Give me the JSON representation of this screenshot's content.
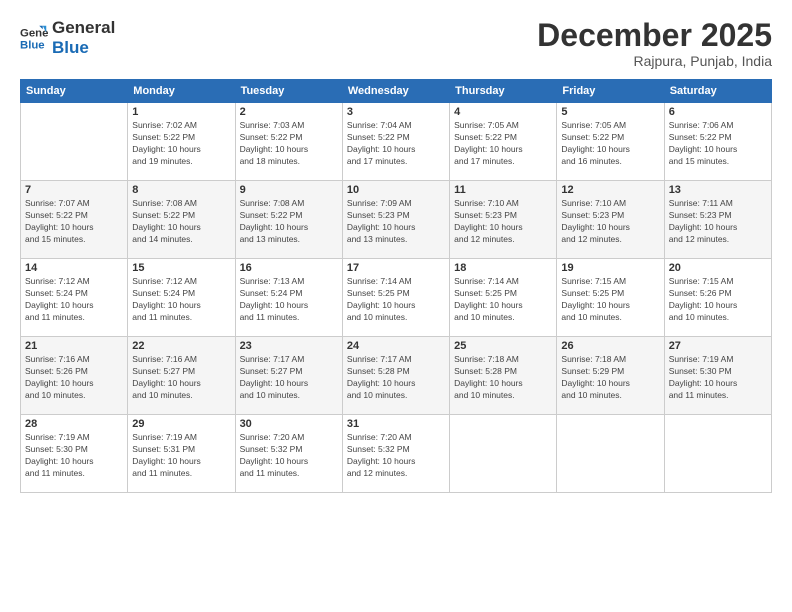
{
  "header": {
    "logo_line1": "General",
    "logo_line2": "Blue",
    "month_title": "December 2025",
    "location": "Rajpura, Punjab, India"
  },
  "weekdays": [
    "Sunday",
    "Monday",
    "Tuesday",
    "Wednesday",
    "Thursday",
    "Friday",
    "Saturday"
  ],
  "weeks": [
    [
      {
        "day": "",
        "info": ""
      },
      {
        "day": "1",
        "info": "Sunrise: 7:02 AM\nSunset: 5:22 PM\nDaylight: 10 hours\nand 19 minutes."
      },
      {
        "day": "2",
        "info": "Sunrise: 7:03 AM\nSunset: 5:22 PM\nDaylight: 10 hours\nand 18 minutes."
      },
      {
        "day": "3",
        "info": "Sunrise: 7:04 AM\nSunset: 5:22 PM\nDaylight: 10 hours\nand 17 minutes."
      },
      {
        "day": "4",
        "info": "Sunrise: 7:05 AM\nSunset: 5:22 PM\nDaylight: 10 hours\nand 17 minutes."
      },
      {
        "day": "5",
        "info": "Sunrise: 7:05 AM\nSunset: 5:22 PM\nDaylight: 10 hours\nand 16 minutes."
      },
      {
        "day": "6",
        "info": "Sunrise: 7:06 AM\nSunset: 5:22 PM\nDaylight: 10 hours\nand 15 minutes."
      }
    ],
    [
      {
        "day": "7",
        "info": "Sunrise: 7:07 AM\nSunset: 5:22 PM\nDaylight: 10 hours\nand 15 minutes."
      },
      {
        "day": "8",
        "info": "Sunrise: 7:08 AM\nSunset: 5:22 PM\nDaylight: 10 hours\nand 14 minutes."
      },
      {
        "day": "9",
        "info": "Sunrise: 7:08 AM\nSunset: 5:22 PM\nDaylight: 10 hours\nand 13 minutes."
      },
      {
        "day": "10",
        "info": "Sunrise: 7:09 AM\nSunset: 5:23 PM\nDaylight: 10 hours\nand 13 minutes."
      },
      {
        "day": "11",
        "info": "Sunrise: 7:10 AM\nSunset: 5:23 PM\nDaylight: 10 hours\nand 12 minutes."
      },
      {
        "day": "12",
        "info": "Sunrise: 7:10 AM\nSunset: 5:23 PM\nDaylight: 10 hours\nand 12 minutes."
      },
      {
        "day": "13",
        "info": "Sunrise: 7:11 AM\nSunset: 5:23 PM\nDaylight: 10 hours\nand 12 minutes."
      }
    ],
    [
      {
        "day": "14",
        "info": "Sunrise: 7:12 AM\nSunset: 5:24 PM\nDaylight: 10 hours\nand 11 minutes."
      },
      {
        "day": "15",
        "info": "Sunrise: 7:12 AM\nSunset: 5:24 PM\nDaylight: 10 hours\nand 11 minutes."
      },
      {
        "day": "16",
        "info": "Sunrise: 7:13 AM\nSunset: 5:24 PM\nDaylight: 10 hours\nand 11 minutes."
      },
      {
        "day": "17",
        "info": "Sunrise: 7:14 AM\nSunset: 5:25 PM\nDaylight: 10 hours\nand 10 minutes."
      },
      {
        "day": "18",
        "info": "Sunrise: 7:14 AM\nSunset: 5:25 PM\nDaylight: 10 hours\nand 10 minutes."
      },
      {
        "day": "19",
        "info": "Sunrise: 7:15 AM\nSunset: 5:25 PM\nDaylight: 10 hours\nand 10 minutes."
      },
      {
        "day": "20",
        "info": "Sunrise: 7:15 AM\nSunset: 5:26 PM\nDaylight: 10 hours\nand 10 minutes."
      }
    ],
    [
      {
        "day": "21",
        "info": "Sunrise: 7:16 AM\nSunset: 5:26 PM\nDaylight: 10 hours\nand 10 minutes."
      },
      {
        "day": "22",
        "info": "Sunrise: 7:16 AM\nSunset: 5:27 PM\nDaylight: 10 hours\nand 10 minutes."
      },
      {
        "day": "23",
        "info": "Sunrise: 7:17 AM\nSunset: 5:27 PM\nDaylight: 10 hours\nand 10 minutes."
      },
      {
        "day": "24",
        "info": "Sunrise: 7:17 AM\nSunset: 5:28 PM\nDaylight: 10 hours\nand 10 minutes."
      },
      {
        "day": "25",
        "info": "Sunrise: 7:18 AM\nSunset: 5:28 PM\nDaylight: 10 hours\nand 10 minutes."
      },
      {
        "day": "26",
        "info": "Sunrise: 7:18 AM\nSunset: 5:29 PM\nDaylight: 10 hours\nand 10 minutes."
      },
      {
        "day": "27",
        "info": "Sunrise: 7:19 AM\nSunset: 5:30 PM\nDaylight: 10 hours\nand 11 minutes."
      }
    ],
    [
      {
        "day": "28",
        "info": "Sunrise: 7:19 AM\nSunset: 5:30 PM\nDaylight: 10 hours\nand 11 minutes."
      },
      {
        "day": "29",
        "info": "Sunrise: 7:19 AM\nSunset: 5:31 PM\nDaylight: 10 hours\nand 11 minutes."
      },
      {
        "day": "30",
        "info": "Sunrise: 7:20 AM\nSunset: 5:32 PM\nDaylight: 10 hours\nand 11 minutes."
      },
      {
        "day": "31",
        "info": "Sunrise: 7:20 AM\nSunset: 5:32 PM\nDaylight: 10 hours\nand 12 minutes."
      },
      {
        "day": "",
        "info": ""
      },
      {
        "day": "",
        "info": ""
      },
      {
        "day": "",
        "info": ""
      }
    ]
  ]
}
